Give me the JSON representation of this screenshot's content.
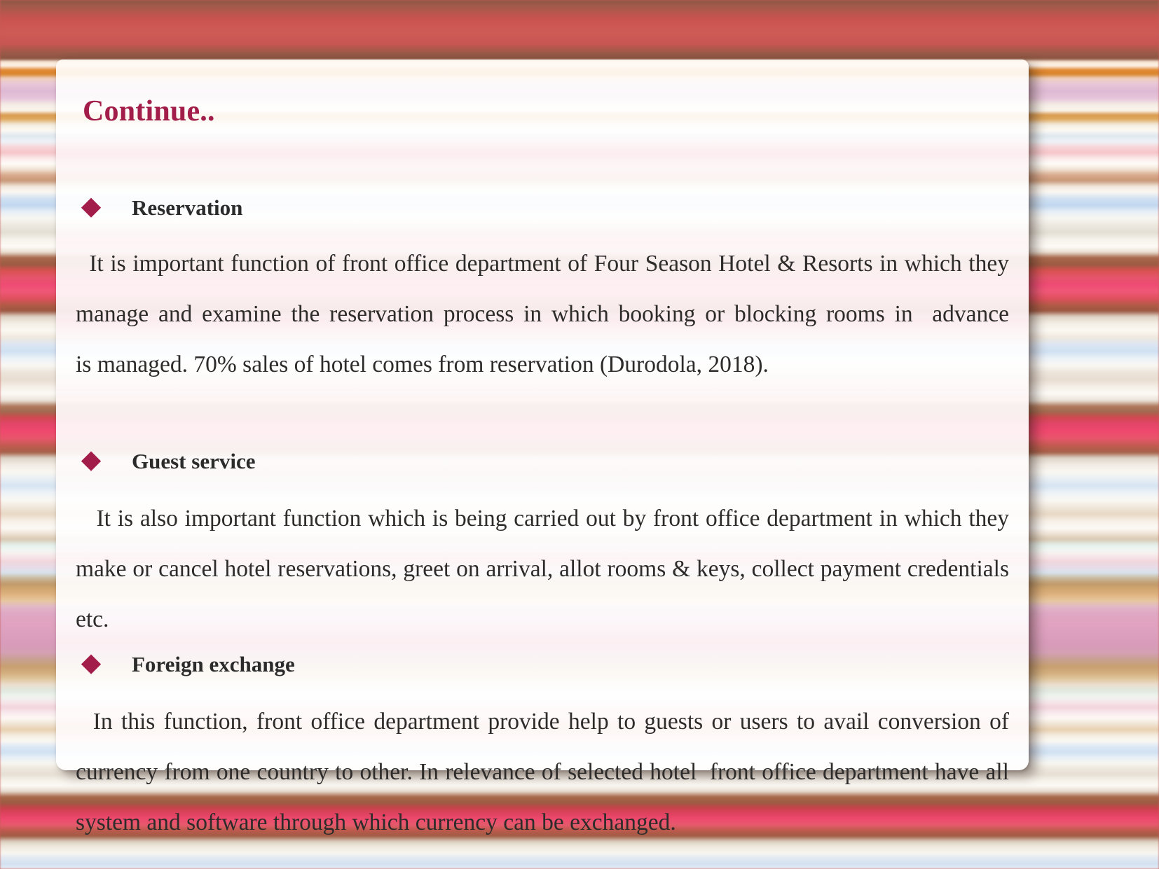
{
  "slide": {
    "title": "Continue..",
    "accent_color": "#a31d4a",
    "text_color": "#2e2b2b",
    "card_background": "#fdfbf8",
    "background_description": "horizontal-striped-red-pink-pattern"
  },
  "sections": [
    {
      "bullet_icon": "diamond-bullet",
      "heading": "Reservation",
      "body": "  It is important function of front office department of Four Season Hotel & Resorts in which they manage and examine the reservation process in which booking or blocking rooms in  advance        is managed. 70% sales of hotel comes from reservation (Durodola, 2018)."
    },
    {
      "bullet_icon": "diamond-bullet",
      "heading": "Guest service",
      "body": "   It is also important function which is being carried out by front office department in which they make or cancel hotel reservations, greet on arrival, allot rooms & keys, collect payment credentials etc."
    },
    {
      "bullet_icon": "diamond-bullet",
      "heading": "Foreign exchange",
      "body": "  In this function, front office department provide help to guests or users to avail conversion of currency from one country to other. In relevance of selected hotel  front office department have all system and software through which currency can be exchanged."
    }
  ]
}
